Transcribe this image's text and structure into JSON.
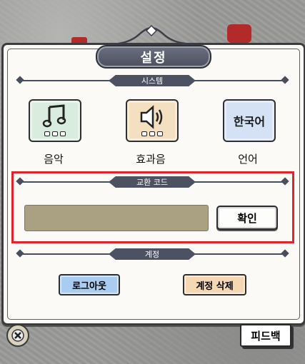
{
  "title": "설정",
  "sections": {
    "system": "시스템",
    "exchange_code": "교환 코드",
    "account": "계정"
  },
  "system_buttons": {
    "music": {
      "label": "음악",
      "icon": "music-note-icon",
      "color": "#d9ecde"
    },
    "sfx": {
      "label": "효과음",
      "icon": "speaker-icon",
      "color": "#f4dfc0"
    },
    "language": {
      "label": "언어",
      "icon_text": "한국어",
      "color": "#d5e1f5"
    }
  },
  "exchange": {
    "input_value": "",
    "confirm_label": "확인"
  },
  "account": {
    "logout_label": "로그아웃",
    "delete_label": "계정 삭제"
  },
  "footer": {
    "feedback_label": "피드백",
    "close_icon": "close-icon"
  },
  "colors": {
    "highlight_box": "#e0242b",
    "logout_bg": "#a9cdf0",
    "delete_bg": "#f6d7b3",
    "input_bg": "#aaa183"
  }
}
